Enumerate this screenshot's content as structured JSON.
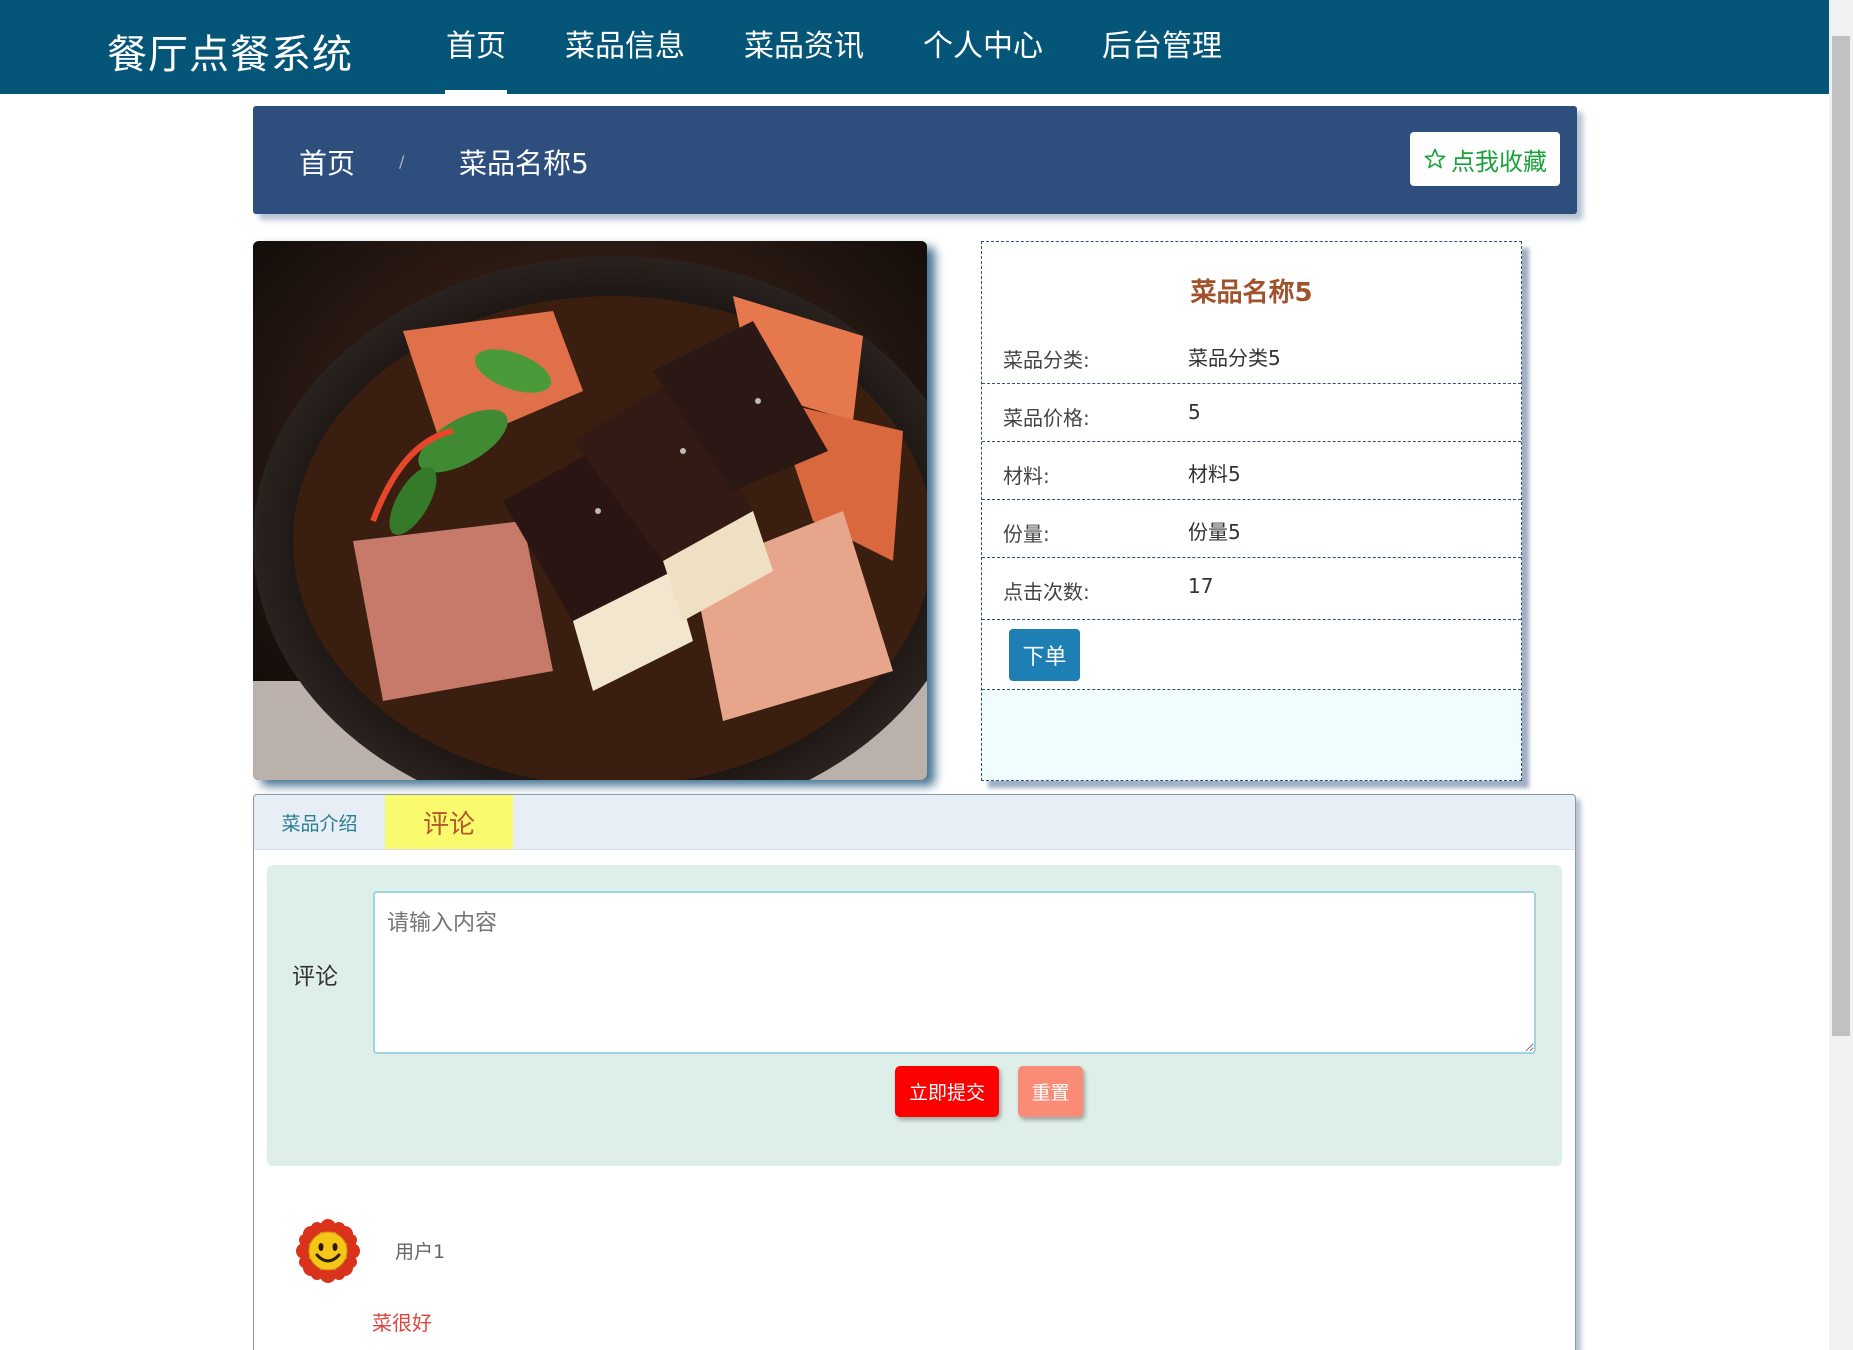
{
  "app": {
    "title": "餐厅点餐系统"
  },
  "nav": {
    "items": [
      {
        "label": "首页",
        "active": true
      },
      {
        "label": "菜品信息",
        "active": false
      },
      {
        "label": "菜品资讯",
        "active": false
      },
      {
        "label": "个人中心",
        "active": false
      },
      {
        "label": "后台管理",
        "active": false
      }
    ]
  },
  "breadcrumb": {
    "home": "首页",
    "separator": "/",
    "current": "菜品名称5"
  },
  "favorite": {
    "icon": "star-outline-icon",
    "label": "点我收藏"
  },
  "dish": {
    "image_alt": "food-photo",
    "name": "菜品名称5",
    "fields": [
      {
        "label": "菜品分类:",
        "value": "菜品分类5"
      },
      {
        "label": "菜品价格:",
        "value": "5"
      },
      {
        "label": "材料:",
        "value": "材料5"
      },
      {
        "label": "份量:",
        "value": "份量5"
      },
      {
        "label": "点击次数:",
        "value": "17"
      }
    ],
    "order_label": "下单"
  },
  "tabs": [
    {
      "label": "菜品介绍",
      "active": false
    },
    {
      "label": "评论",
      "active": true
    }
  ],
  "comment_form": {
    "label": "评论",
    "placeholder": "请输入内容",
    "value": "",
    "submit_label": "立即提交",
    "reset_label": "重置"
  },
  "comments": [
    {
      "user": "用户1",
      "text": "菜很好",
      "avatar_icon": "smiley-flower-icon"
    }
  ],
  "colors": {
    "topbar": "#055578",
    "breadcrumb_bar": "#2e4e7e",
    "favorite_text": "#1aa33a",
    "dish_title": "#a0522d",
    "order_button": "#1d7fb3",
    "active_tab": "#fafa6e",
    "submit_button": "#ff0000",
    "reset_button": "#fa8c77",
    "comment_text": "#e0443f"
  }
}
